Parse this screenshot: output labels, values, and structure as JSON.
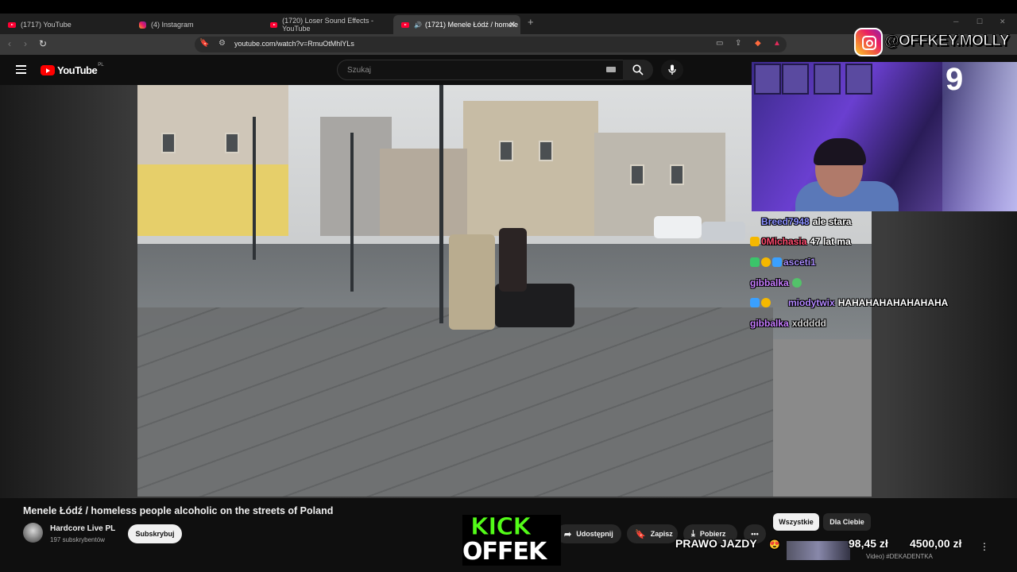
{
  "browser": {
    "tabs": [
      {
        "label": "(1717) YouTube",
        "type": "youtube"
      },
      {
        "label": "(4) Instagram",
        "type": "instagram"
      },
      {
        "label": "(1720) Loser Sound Effects - YouTube",
        "type": "youtube"
      },
      {
        "label": "(1721) Menele Łódź / homele",
        "type": "youtube",
        "active": true
      }
    ],
    "url": "youtube.com/watch?v=RmuOtMhlYLs"
  },
  "youtube": {
    "logo_text": "YouTube",
    "country": "PL",
    "search_placeholder": "Szukaj",
    "video_title": "Menele Łódź / homeless people alcoholic on the streets of Poland",
    "channel_name": "Hardcore Live PL",
    "subscribers": "197 subskrybentów",
    "subscribe_label": "Subskrybuj",
    "share_label": "Udostępnij",
    "save_label": "Zapisz",
    "download_label": "Pobierz",
    "more_label": "•••",
    "chips": [
      "Wszystkie",
      "Dla Ciebie"
    ],
    "recommended_snippet": "Video) #DEKADENTKA"
  },
  "overlay": {
    "instagram_handle": "@OFFKEY.MOLLY",
    "cam_number": "9",
    "kick_line1": "KICK",
    "kick_line2": "OFFEK",
    "goal_text": "PRAWO JAZDY",
    "goal_current": "98,45 zł",
    "goal_target": "4500,00 zł"
  },
  "chat": [
    {
      "user": "Breed7948",
      "msg": "ale stara",
      "color": "#8a8fff"
    },
    {
      "user": "0Michasia",
      "msg": "47 lat ma",
      "color": "#ff4a6e"
    },
    {
      "user": "asceti1",
      "msg": "",
      "color": "#a78bfa"
    },
    {
      "user": "gibbalka",
      "msg": "",
      "color": "#c77dff"
    },
    {
      "user": "miodytwix",
      "msg": "HAHAHAHAHAHAHAHA",
      "color": "#b388ff"
    },
    {
      "user": "gibbalka",
      "msg": "xddddd",
      "color": "#c77dff"
    }
  ],
  "colors": {
    "youtube_red": "#ff0000",
    "kick_green": "#53fc18",
    "bg": "#0f0f0f"
  }
}
